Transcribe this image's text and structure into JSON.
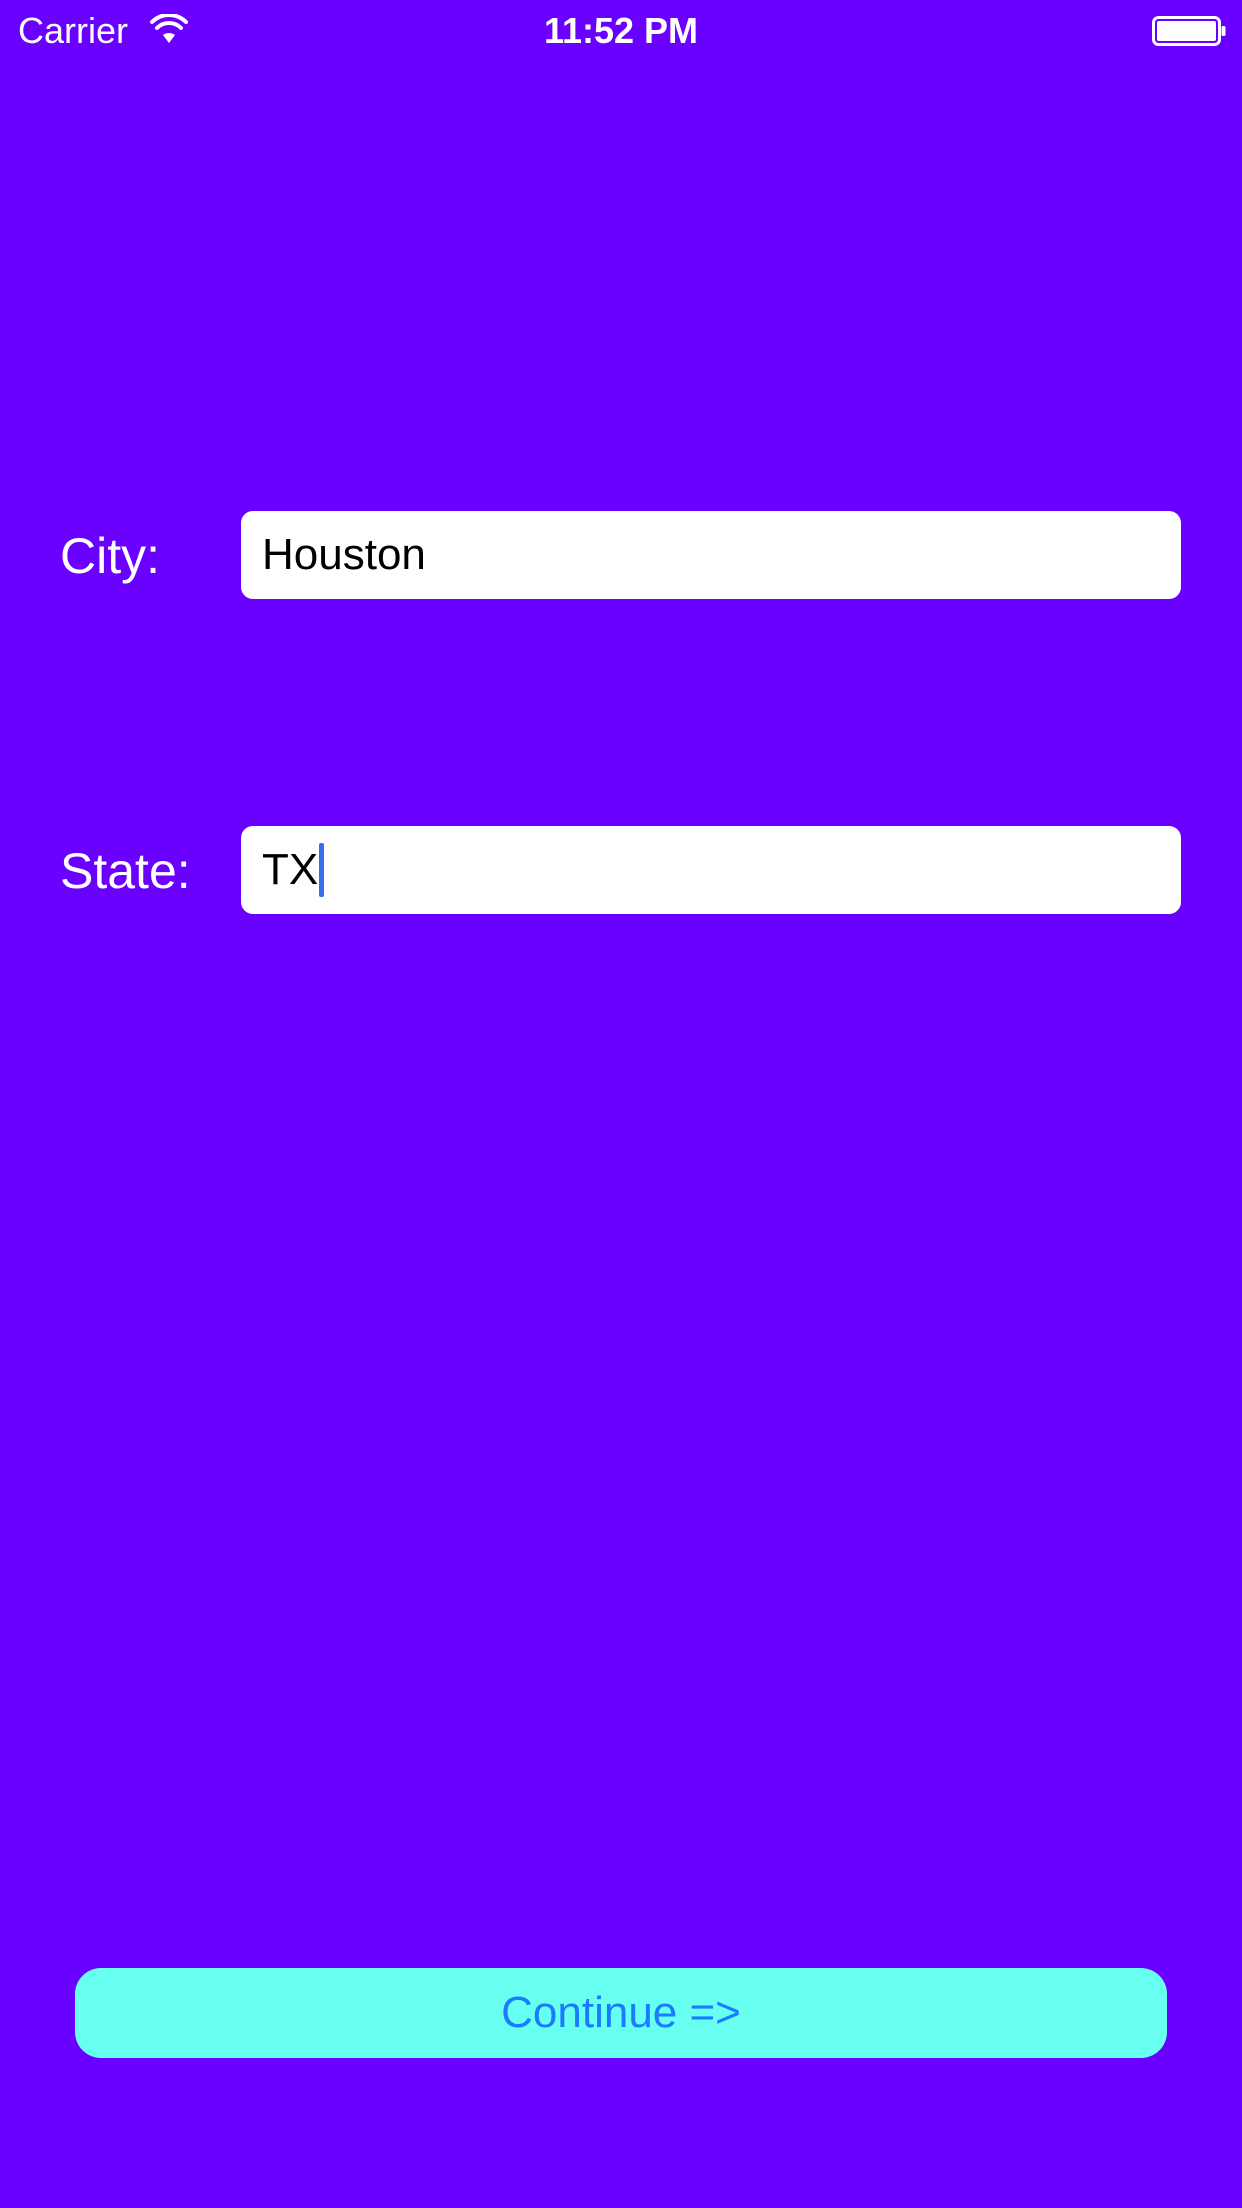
{
  "status_bar": {
    "carrier": "Carrier",
    "time": "11:52 PM",
    "wifi_icon": "wifi-icon",
    "battery_icon": "battery-full-icon"
  },
  "form": {
    "city": {
      "label": "City:",
      "value": "Houston"
    },
    "state": {
      "label": "State:",
      "value": "TX",
      "focused": true
    }
  },
  "continue_button": {
    "label": "Continue =>"
  },
  "colors": {
    "background": "#6a00ff",
    "field_background": "#ffffff",
    "button_background": "#66fff0",
    "button_text": "#1a7bff",
    "cursor": "#3b6cf0"
  }
}
